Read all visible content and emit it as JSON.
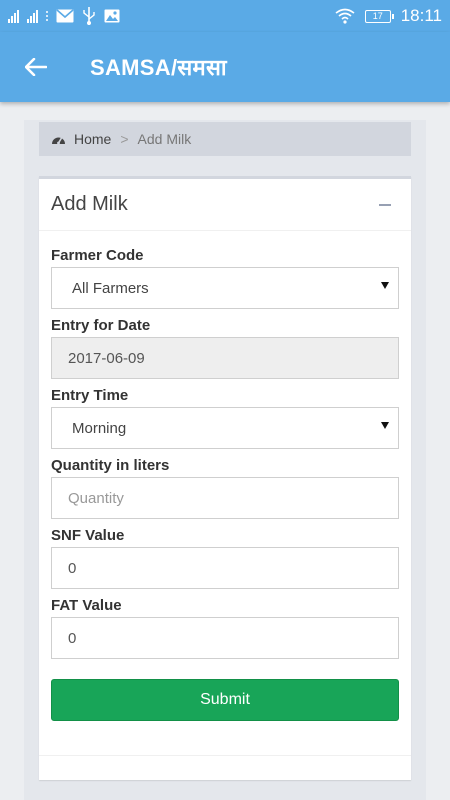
{
  "status_bar": {
    "signal_label_1": "",
    "signal_label_2": "",
    "battery_level": "17",
    "time": "18:11"
  },
  "app_bar": {
    "title": "SAMSA/समसा"
  },
  "breadcrumb": {
    "home": "Home",
    "separator": ">",
    "current": "Add Milk"
  },
  "card": {
    "title": "Add Milk",
    "collapse_symbol": "−"
  },
  "form": {
    "farmer_code": {
      "label": "Farmer Code",
      "value": "All Farmers"
    },
    "entry_date": {
      "label": "Entry for Date",
      "value": "2017-06-09"
    },
    "entry_time": {
      "label": "Entry Time",
      "value": "Morning"
    },
    "quantity": {
      "label": "Quantity in liters",
      "placeholder": "Quantity"
    },
    "snf": {
      "label": "SNF Value",
      "value": "0"
    },
    "fat": {
      "label": "FAT Value",
      "value": "0"
    },
    "submit_label": "Submit"
  },
  "colors": {
    "primary": "#5aaae6",
    "submit": "#18a558"
  },
  "icons": {
    "back": "arrow-left-icon",
    "home": "dashboard-gauge-icon",
    "collapse": "minus-icon"
  }
}
